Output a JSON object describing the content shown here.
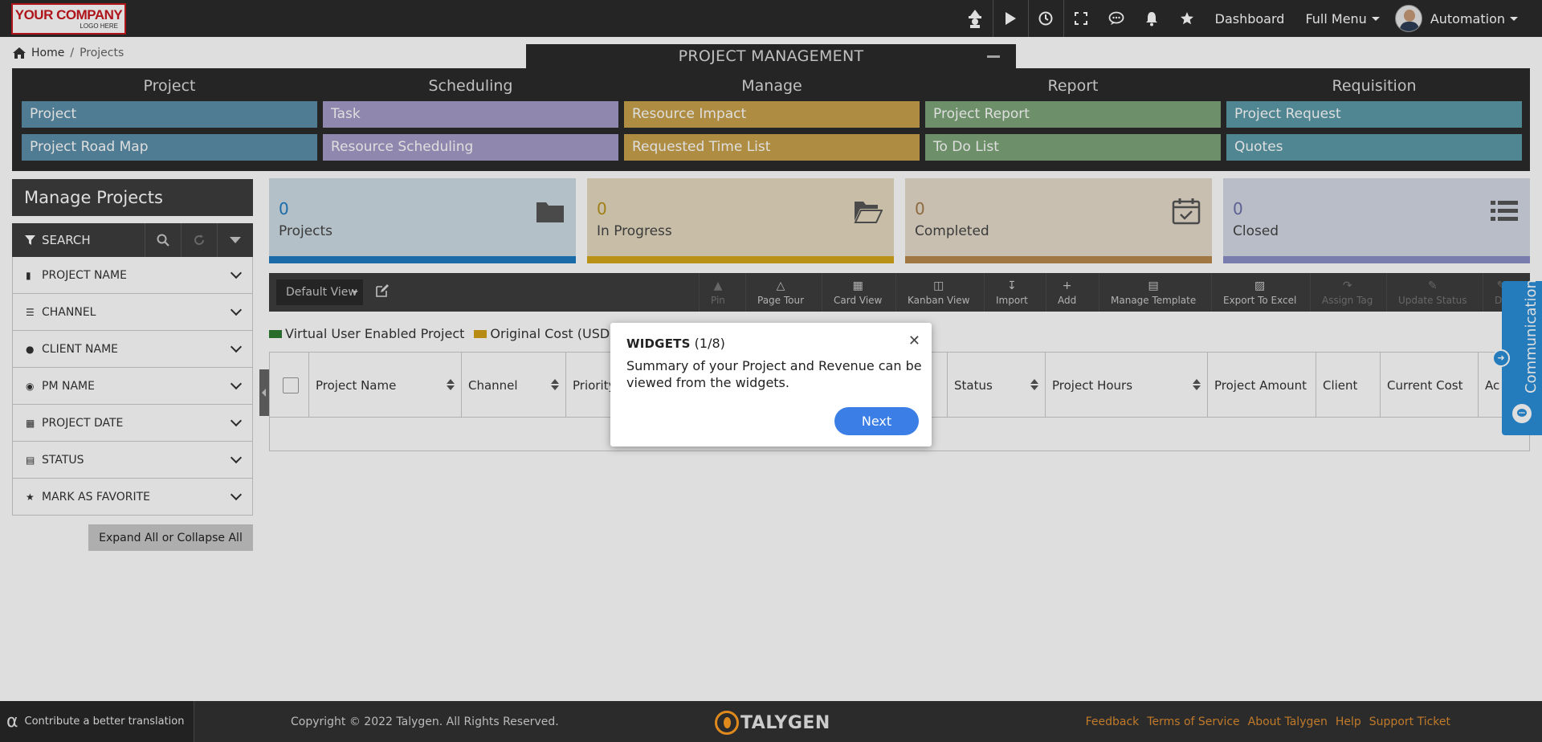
{
  "header": {
    "logo_line1": "YOUR COMPANY",
    "logo_line2": "LOGO HERE",
    "nav_dashboard": "Dashboard",
    "nav_full_menu": "Full Menu",
    "user_name": "Automation"
  },
  "breadcrumb": {
    "home": "Home",
    "current": "Projects",
    "separator": "/"
  },
  "project_management": {
    "title": "PROJECT MANAGEMENT",
    "columns": [
      {
        "heading": "Project",
        "color": "#5b8fa8",
        "items": [
          "Project",
          "Project Road Map"
        ]
      },
      {
        "heading": "Scheduling",
        "color": "#a69bc8",
        "items": [
          "Task",
          "Resource Scheduling"
        ]
      },
      {
        "heading": "Manage",
        "color": "#c8a24e",
        "items": [
          "Resource Impact",
          "Requested Time List"
        ]
      },
      {
        "heading": "Report",
        "color": "#7ea67a",
        "items": [
          "Project Report",
          "To Do List"
        ]
      },
      {
        "heading": "Requisition",
        "color": "#5b9aa8",
        "items": [
          "Project Request",
          "Quotes"
        ]
      }
    ]
  },
  "sidebar": {
    "title": "Manage Projects",
    "search_label": "SEARCH",
    "filters": [
      "PROJECT NAME",
      "CHANNEL",
      "CLIENT NAME",
      "PM NAME",
      "PROJECT DATE",
      "STATUS",
      "MARK AS FAVORITE"
    ],
    "expand_label": "Expand All or Collapse All"
  },
  "widgets": [
    {
      "count": "0",
      "label": "Projects",
      "bg": "#cfdde6",
      "bar": "#1f7bc1",
      "num_color": "#1f7bc1"
    },
    {
      "count": "0",
      "label": "In Progress",
      "bg": "#e6dbc2",
      "bar": "#d4a71a",
      "num_color": "#b8921a"
    },
    {
      "count": "0",
      "label": "Completed",
      "bg": "#e6dccc",
      "bar": "#b8894e",
      "num_color": "#a37a4a"
    },
    {
      "count": "0",
      "label": "Closed",
      "bg": "#d4d9e6",
      "bar": "#8a90c8",
      "num_color": "#6a70a8"
    }
  ],
  "toolbar": {
    "view": "Default View",
    "buttons": [
      {
        "label": "Pin",
        "disabled": true
      },
      {
        "label": "Page Tour",
        "disabled": false
      },
      {
        "label": "Card View",
        "disabled": false
      },
      {
        "label": "Kanban View",
        "disabled": false
      },
      {
        "label": "Import",
        "disabled": false
      },
      {
        "label": "Add",
        "disabled": false
      },
      {
        "label": "Manage Template",
        "disabled": false
      },
      {
        "label": "Export To Excel",
        "disabled": false
      },
      {
        "label": "Assign Tag",
        "disabled": true
      },
      {
        "label": "Update Status",
        "disabled": true
      },
      {
        "label": "De",
        "disabled": true
      }
    ]
  },
  "legend": [
    {
      "label": "Virtual User Enabled Project",
      "color": "#2e7d32"
    },
    {
      "label": "Original Cost (USD)",
      "color": "#d4a017"
    }
  ],
  "table": {
    "columns": [
      "Project Name",
      "Channel",
      "Priority",
      "Status",
      "Project Hours",
      "Project Amount",
      "Client",
      "Current Cost",
      "Ac"
    ]
  },
  "communication": {
    "label": "Communication"
  },
  "popover": {
    "title": "WIDGETS",
    "step": "(1/8)",
    "body": "Summary of your Project and Revenue can be viewed from the widgets.",
    "next": "Next"
  },
  "footer": {
    "translate": "Contribute a better translation",
    "copyright": "Copyright © 2022 Talygen. All Rights Reserved.",
    "brand": "TALYGEN",
    "links": [
      "Feedback",
      "Terms of Service",
      "About Talygen",
      "Help",
      "Support Ticket"
    ]
  }
}
